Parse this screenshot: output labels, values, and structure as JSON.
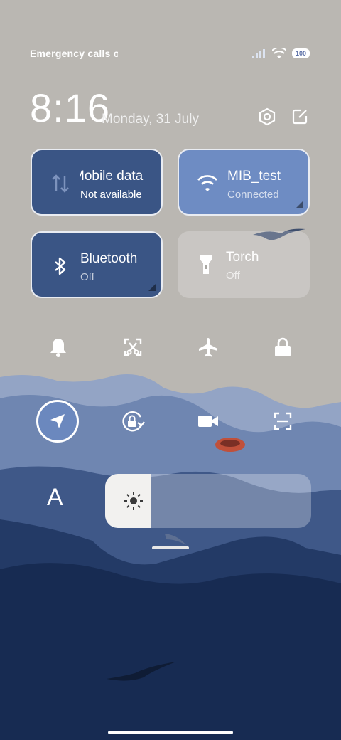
{
  "status_bar": {
    "carrier_text": "Emergency calls only",
    "battery": "100"
  },
  "header": {
    "time": "8:16",
    "date": "Monday, 31 July"
  },
  "tiles": {
    "mobile_data": {
      "name": "Mobile data",
      "state": "Not available"
    },
    "wifi": {
      "name": "MIB_test",
      "state": "Connected"
    },
    "bluetooth": {
      "name": "Bluetooth",
      "state": "Off"
    },
    "torch": {
      "name": "Torch",
      "state": "Off"
    }
  },
  "toggles": {
    "row1": [
      "bell-icon",
      "screenshot-icon",
      "airplane-icon",
      "lock-icon"
    ],
    "row2": [
      "location-icon",
      "rotation-lock-icon",
      "video-icon",
      "scanner-icon"
    ]
  },
  "brightness": {
    "auto_label": "A",
    "level": 0.22
  },
  "colors": {
    "tile_active_dark": "#3a5585",
    "tile_active_light": "#6e8cc3",
    "sky": "#b9b6b1",
    "deep_sea": "#14264a"
  }
}
